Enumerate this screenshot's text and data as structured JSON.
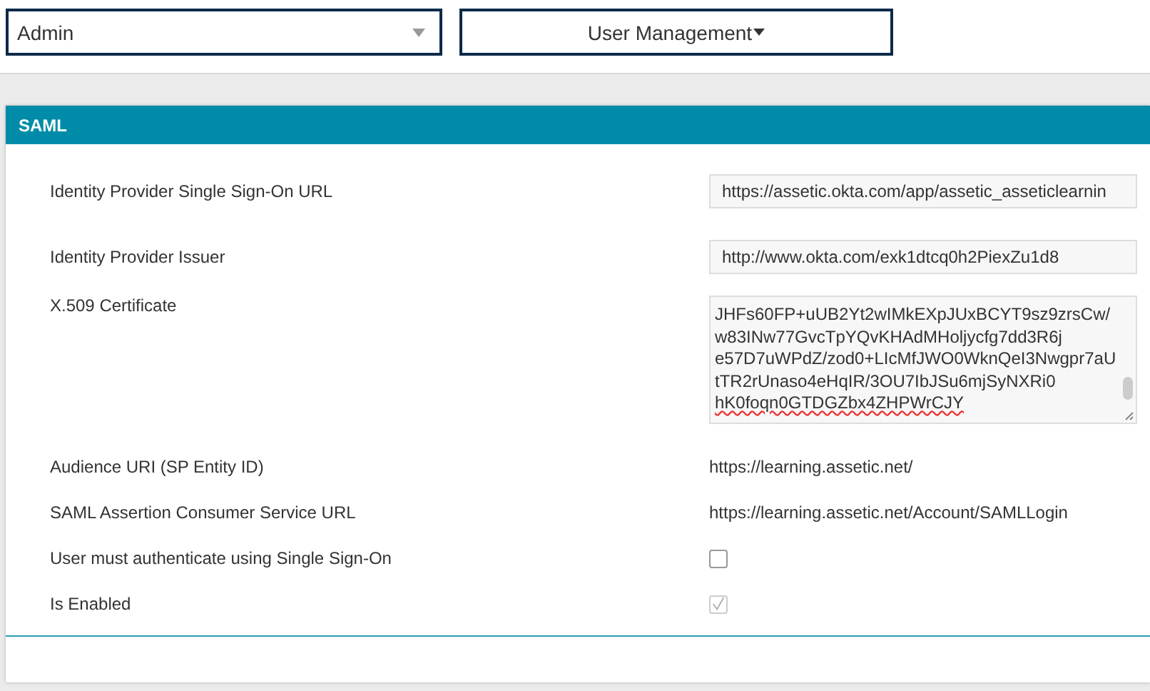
{
  "top_bar": {
    "module_select": {
      "value": "Admin"
    },
    "menu_button": {
      "label": "User Management"
    }
  },
  "panel": {
    "title": "SAML",
    "fields": [
      {
        "kind": "input",
        "label": "Identity Provider Single Sign-On URL",
        "value": "https://assetic.okta.com/app/assetic_asseticlearnin"
      },
      {
        "kind": "input",
        "label": "Identity Provider Issuer",
        "value": "http://www.okta.com/exk1dtcq0h2PiexZu1d8"
      },
      {
        "kind": "textarea",
        "label": "X.509 Certificate",
        "lines": [
          "JHFs60FP+uUB2Yt2wIMkEXpJUxBCYT9sz9zrsCw/",
          "w83INw77GvcTpYQvKHAdMHoljycfg7dd3R6j",
          "e57D7uWPdZ/zod0+LIcMfJWO0WknQeI3Nwgpr7aU",
          "tTR2rUnaso4eHqIR/3OU7IbJSu6mjSyNXRi0",
          "hK0foqn0GTDGZbx4ZHPWrCJY"
        ]
      },
      {
        "kind": "text",
        "label": "Audience URI (SP Entity ID)",
        "value": "https://learning.assetic.net/"
      },
      {
        "kind": "text",
        "label": "SAML Assertion Consumer Service URL",
        "value": "https://learning.assetic.net/Account/SAMLLogin"
      },
      {
        "kind": "checkbox",
        "label": "User must authenticate using Single Sign-On",
        "checked": false,
        "disabled": false
      },
      {
        "kind": "checkbox",
        "label": "Is Enabled",
        "checked": true,
        "disabled": true
      }
    ]
  }
}
